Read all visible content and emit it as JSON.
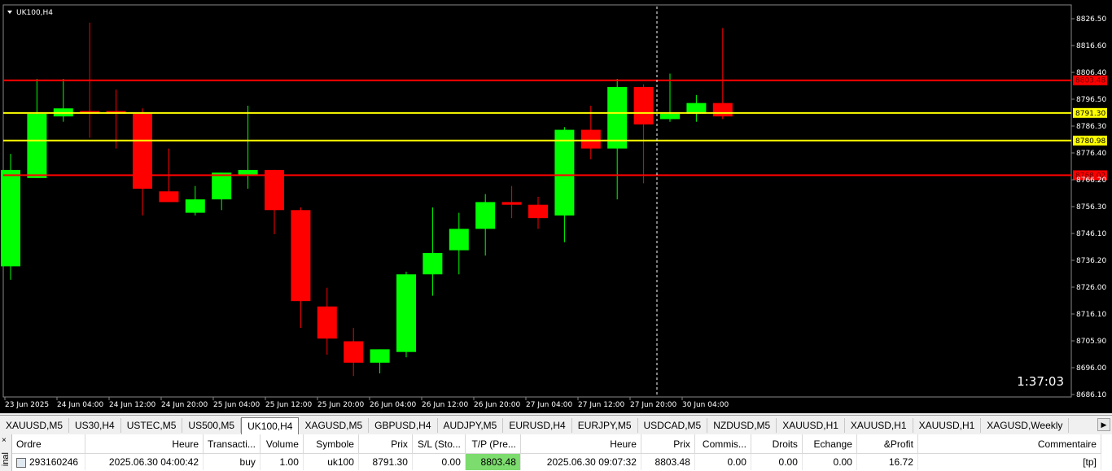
{
  "chart": {
    "symbol_title": "UK100,H4",
    "timer": "1:37:03",
    "colors": {
      "background": "#000000",
      "bull": "#00ff00",
      "bear": "#ff0000",
      "wick_bull": "#00ff00",
      "wick_bear": "#ff0000",
      "h_red": "#ff0000",
      "h_yellow": "#ffff00",
      "tag_red_bg": "#ff0000",
      "tag_yellow_bg": "#ffff00"
    },
    "y_axis_labels": [
      "8826.50",
      "8816.60",
      "8806.40",
      "8796.50",
      "8786.30",
      "8776.40",
      "8766.20",
      "8756.30",
      "8746.10",
      "8736.20",
      "8726.00",
      "8716.10",
      "8705.90",
      "8696.00",
      "8686.10"
    ],
    "x_axis_labels": [
      "23 Jun 2025",
      "24 Jun 04:00",
      "24 Jun 12:00",
      "24 Jun 20:00",
      "25 Jun 04:00",
      "25 Jun 12:00",
      "25 Jun 20:00",
      "26 Jun 04:00",
      "26 Jun 12:00",
      "26 Jun 20:00",
      "27 Jun 04:00",
      "27 Jun 12:00",
      "27 Jun 20:00",
      "30 Jun 04:00"
    ],
    "level_tags": [
      {
        "label": "8803.48",
        "kind": "red",
        "price": 8803.48
      },
      {
        "label": "8791.30",
        "kind": "yellow",
        "price": 8791.3
      },
      {
        "label": "8780.98",
        "kind": "yellow",
        "price": 8780.98
      },
      {
        "label": "8768.02",
        "kind": "red",
        "price": 8768.02
      }
    ],
    "candles": [
      {
        "o": 8734,
        "h": 8776,
        "l": 8729,
        "c": 8770
      },
      {
        "o": 8767,
        "h": 8804,
        "l": 8767,
        "c": 8791
      },
      {
        "o": 8790,
        "h": 8804,
        "l": 8788,
        "c": 8793
      },
      {
        "o": 8792,
        "h": 8825,
        "l": 8782,
        "c": 8791
      },
      {
        "o": 8792,
        "h": 8800,
        "l": 8778,
        "c": 8791
      },
      {
        "o": 8791,
        "h": 8793,
        "l": 8753,
        "c": 8763
      },
      {
        "o": 8762,
        "h": 8778,
        "l": 8758,
        "c": 8758
      },
      {
        "o": 8754,
        "h": 8764,
        "l": 8753,
        "c": 8759
      },
      {
        "o": 8759,
        "h": 8769,
        "l": 8755,
        "c": 8769
      },
      {
        "o": 8768,
        "h": 8794,
        "l": 8763,
        "c": 8770
      },
      {
        "o": 8770,
        "h": 8770,
        "l": 8746,
        "c": 8755
      },
      {
        "o": 8755,
        "h": 8756,
        "l": 8711,
        "c": 8721
      },
      {
        "o": 8719,
        "h": 8726,
        "l": 8701,
        "c": 8707
      },
      {
        "o": 8706,
        "h": 8711,
        "l": 8693,
        "c": 8698
      },
      {
        "o": 8698,
        "h": 8703,
        "l": 8694,
        "c": 8703
      },
      {
        "o": 8702,
        "h": 8732,
        "l": 8700,
        "c": 8731
      },
      {
        "o": 8731,
        "h": 8756,
        "l": 8723,
        "c": 8739
      },
      {
        "o": 8740,
        "h": 8754,
        "l": 8731,
        "c": 8748
      },
      {
        "o": 8748,
        "h": 8761,
        "l": 8738,
        "c": 8758
      },
      {
        "o": 8758,
        "h": 8764,
        "l": 8752,
        "c": 8757
      },
      {
        "o": 8757,
        "h": 8760,
        "l": 8748,
        "c": 8752
      },
      {
        "o": 8753,
        "h": 8786,
        "l": 8743,
        "c": 8785
      },
      {
        "o": 8785,
        "h": 8794,
        "l": 8774,
        "c": 8778
      },
      {
        "o": 8778,
        "h": 8804,
        "l": 8759,
        "c": 8801
      },
      {
        "o": 8801,
        "h": 8802,
        "l": 8765,
        "c": 8787
      },
      {
        "o": 8789,
        "h": 8806,
        "l": 8788,
        "c": 8791
      },
      {
        "o": 8791,
        "h": 8798,
        "l": 8788,
        "c": 8795
      },
      {
        "o": 8795,
        "h": 8823,
        "l": 8789,
        "c": 8790
      }
    ]
  },
  "tabs": [
    {
      "label": "XAUUSD,M5",
      "active": false
    },
    {
      "label": "US30,H4",
      "active": false
    },
    {
      "label": "USTEC,M5",
      "active": false
    },
    {
      "label": "US500,M5",
      "active": false
    },
    {
      "label": "UK100,H4",
      "active": true
    },
    {
      "label": "XAGUSD,M5",
      "active": false
    },
    {
      "label": "GBPUSD,H4",
      "active": false
    },
    {
      "label": "AUDJPY,M5",
      "active": false
    },
    {
      "label": "EURUSD,H4",
      "active": false
    },
    {
      "label": "EURJPY,M5",
      "active": false
    },
    {
      "label": "USDCAD,M5",
      "active": false
    },
    {
      "label": "NZDUSD,M5",
      "active": false
    },
    {
      "label": "XAUUSD,H1",
      "active": false
    },
    {
      "label": "XAUUSD,H1",
      "active": false
    },
    {
      "label": "XAUUSD,H1",
      "active": false
    },
    {
      "label": "XAGUSD,Weekly",
      "active": false
    }
  ],
  "terminal": {
    "side_label": "inal",
    "close_glyph": "×",
    "headers": [
      "Ordre",
      "Heure",
      "Transacti...",
      "Volume",
      "Symbole",
      "Prix",
      "S/L (Sto...",
      "T/P (Pre...",
      "Heure",
      "Prix",
      "Commis...",
      "Droits",
      "Echange",
      "&Profit",
      "Commentaire"
    ],
    "row": [
      "293160246",
      "2025.06.30 04:00:42",
      "buy",
      "1.00",
      "uk100",
      "8791.30",
      "0.00",
      "8803.48",
      "2025.06.30 09:07:32",
      "8803.48",
      "0.00",
      "0.00",
      "0.00",
      "16.72",
      "[tp]"
    ]
  }
}
